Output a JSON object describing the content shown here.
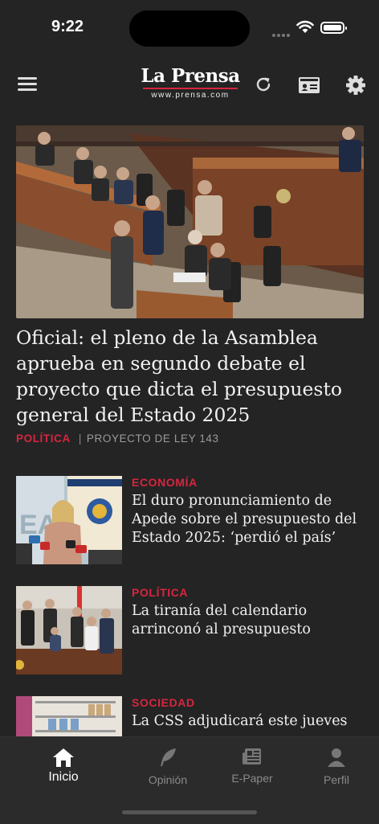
{
  "status": {
    "time": "9:22"
  },
  "header": {
    "logo_name": "La Prensa",
    "logo_url": "www.prensa.com",
    "icons": [
      "menu-icon",
      "refresh-icon",
      "id-card-icon",
      "gear-icon"
    ]
  },
  "featured": {
    "title": "Oficial: el pleno de la Asamblea aprueba en segundo debate el proyecto que dicta el presupuesto general del Estado 2025",
    "category": "POLÍTICA",
    "separator": "|",
    "subcategory": "PROYECTO DE LEY 143"
  },
  "articles": [
    {
      "category": "ECONOMÍA",
      "title": "El duro pronunciamiento de Apede sobre el presupuesto del Estado 2025: ‘perdió el país’"
    },
    {
      "category": "POLÍTICA",
      "title": "La tiranía del calendario arrinconó al presupuesto"
    },
    {
      "category": "SOCIEDAD",
      "title": "La CSS adjudicará este jueves"
    }
  ],
  "tabs": [
    {
      "label": "Inicio",
      "icon": "home-icon",
      "active": true
    },
    {
      "label": "Opinión",
      "icon": "feather-icon",
      "active": false
    },
    {
      "label": "E-Paper",
      "icon": "newspaper-icon",
      "active": false
    },
    {
      "label": "Perfil",
      "icon": "user-icon",
      "active": false
    }
  ],
  "colors": {
    "accent": "#d6263f",
    "background": "#242424",
    "tabbar": "#2b2b2b"
  }
}
